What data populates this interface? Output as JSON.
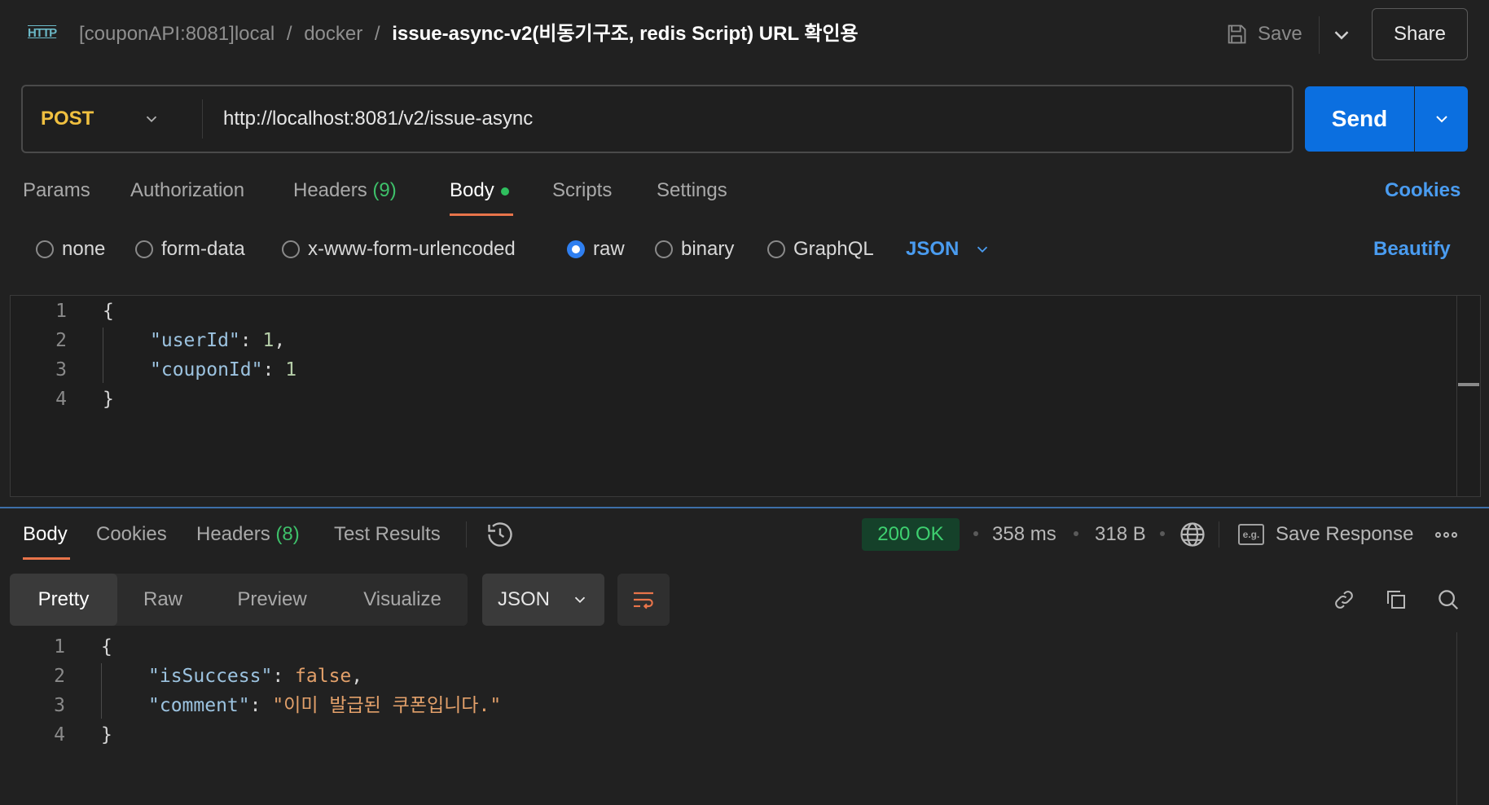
{
  "header": {
    "icon_text": "HTTP",
    "breadcrumb": [
      {
        "label": "[couponAPI:8081]local"
      },
      {
        "label": "docker"
      }
    ],
    "separator": "/",
    "request_title": "issue-async-v2(비동기구조, redis Script) URL 확인용",
    "save_label": "Save",
    "share_label": "Share"
  },
  "request": {
    "method": "POST",
    "url": "http://localhost:8081/v2/issue-async",
    "send_label": "Send",
    "tabs": [
      {
        "label": "Params"
      },
      {
        "label": "Authorization"
      },
      {
        "label": "Headers",
        "count": "(9)"
      },
      {
        "label": "Body",
        "active": true
      },
      {
        "label": "Scripts"
      },
      {
        "label": "Settings"
      }
    ],
    "cookies_label": "Cookies",
    "body_types": [
      {
        "label": "none",
        "selected": false
      },
      {
        "label": "form-data",
        "selected": false
      },
      {
        "label": "x-www-form-urlencoded",
        "selected": false
      },
      {
        "label": "raw",
        "selected": true
      },
      {
        "label": "binary",
        "selected": false
      },
      {
        "label": "GraphQL",
        "selected": false
      }
    ],
    "body_format": "JSON",
    "beautify_label": "Beautify",
    "body_lines": [
      {
        "num": "1",
        "text": "{"
      },
      {
        "num": "2",
        "key": "\"userId\"",
        "sep": ": ",
        "value": "1",
        "tail": ","
      },
      {
        "num": "3",
        "key": "\"couponId\"",
        "sep": ": ",
        "value": "1",
        "tail": ""
      },
      {
        "num": "4",
        "text": "}"
      }
    ]
  },
  "response": {
    "tabs": [
      {
        "label": "Body",
        "active": true
      },
      {
        "label": "Cookies"
      },
      {
        "label": "Headers",
        "count": "(8)"
      },
      {
        "label": "Test Results"
      }
    ],
    "status": "200 OK",
    "time": "358 ms",
    "size": "318 B",
    "save_response_label": "Save Response",
    "eg_label": "e.g.",
    "view_modes": [
      "Pretty",
      "Raw",
      "Preview",
      "Visualize"
    ],
    "format": "JSON",
    "body_lines": [
      {
        "num": "1",
        "text": "{"
      },
      {
        "num": "2",
        "key": "\"isSuccess\"",
        "sep": ": ",
        "value": "false",
        "tail": ","
      },
      {
        "num": "3",
        "key": "\"comment\"",
        "sep": ": ",
        "value": "\"이미 발급된 쿠폰입니다.\"",
        "tail": ""
      },
      {
        "num": "4",
        "text": "}"
      }
    ]
  },
  "colors": {
    "accent_blue": "#0b6fe0",
    "method_yellow": "#f0c040",
    "status_green": "#3ed070",
    "tab_underline": "#e8744a"
  }
}
